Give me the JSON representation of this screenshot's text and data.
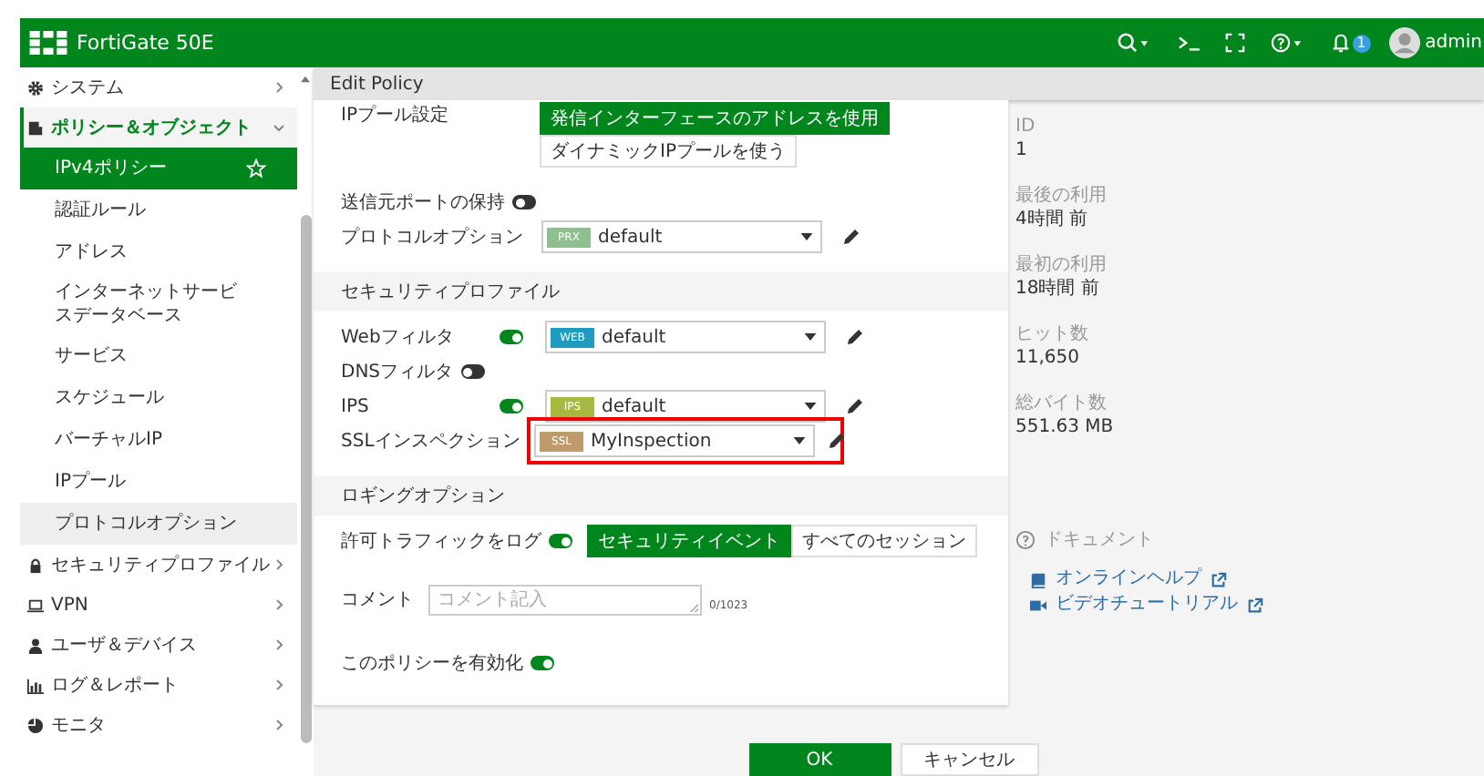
{
  "header": {
    "title": "FortiGate 50E",
    "notifications": "1",
    "user": "admin"
  },
  "sidebar": {
    "items": [
      {
        "label": "システム",
        "expanded": false,
        "selected": false,
        "hovered": false
      },
      {
        "label": "ポリシー＆オブジェクト",
        "expanded": true,
        "selected": false,
        "hovered": false,
        "children": [
          {
            "label": "IPv4ポリシー",
            "selected": true,
            "hovered": false
          },
          {
            "label": "認証ルール",
            "selected": false,
            "hovered": false
          },
          {
            "label": "アドレス",
            "selected": false,
            "hovered": false
          },
          {
            "label": "インターネットサービスデータベース",
            "selected": false,
            "hovered": false
          },
          {
            "label": "サービス",
            "selected": false,
            "hovered": false
          },
          {
            "label": "スケジュール",
            "selected": false,
            "hovered": false
          },
          {
            "label": "バーチャルIP",
            "selected": false,
            "hovered": false
          },
          {
            "label": "IPプール",
            "selected": false,
            "hovered": false
          },
          {
            "label": "プロトコルオプション",
            "selected": false,
            "hovered": true
          }
        ]
      },
      {
        "label": "セキュリティプロファイル",
        "expanded": false,
        "selected": false,
        "hovered": false
      },
      {
        "label": "VPN",
        "expanded": false,
        "selected": false,
        "hovered": false
      },
      {
        "label": "ユーザ＆デバイス",
        "expanded": false,
        "selected": false,
        "hovered": false
      },
      {
        "label": "ログ＆レポート",
        "expanded": false,
        "selected": false,
        "hovered": false
      },
      {
        "label": "モニタ",
        "expanded": false,
        "selected": false,
        "hovered": false
      }
    ]
  },
  "page_title": "Edit Policy",
  "form": {
    "rows": [
      {
        "kind": "options",
        "label": "IPプール設定",
        "options": [
          {
            "label": "発信インターフェースのアドレスを使用",
            "selected": true
          },
          {
            "label": "ダイナミックIPプールを使う",
            "selected": false
          }
        ]
      },
      {
        "kind": "toggle",
        "label": "送信元ポートの保持",
        "on": false
      },
      {
        "kind": "select",
        "label": "プロトコルオプション",
        "badge": "PRX",
        "color": "#8fbf8f",
        "value": "default"
      },
      {
        "kind": "section",
        "label": "セキュリティプロファイル"
      },
      {
        "kind": "toggle-select",
        "label": "Webフィルタ",
        "on": true,
        "badge": "WEB",
        "color": "#1f9bc0",
        "value": "default"
      },
      {
        "kind": "toggle",
        "label": "DNSフィルタ",
        "on": false
      },
      {
        "kind": "toggle-select",
        "label": "IPS",
        "on": true,
        "badge": "IPS",
        "color": "#a9b93f",
        "value": "default"
      },
      {
        "kind": "select",
        "label": "SSLインスペクション",
        "badge": "SSL",
        "color": "#bf9b6b",
        "value": "MyInspection",
        "highlighted": true
      },
      {
        "kind": "section",
        "label": "ロギングオプション"
      },
      {
        "kind": "toggle-options",
        "label": "許可トラフィックをログ",
        "on": true,
        "options": [
          {
            "label": "セキュリティイベント",
            "selected": true
          },
          {
            "label": "すべてのセッション",
            "selected": false
          }
        ]
      },
      {
        "kind": "comment",
        "label": "コメント",
        "placeholder": "コメント記入",
        "counter": "0/1023"
      },
      {
        "kind": "toggle",
        "label": "このポリシーを有効化",
        "on": true
      }
    ]
  },
  "info": [
    {
      "label": "ID",
      "value": "1"
    },
    {
      "label": "最後の利用",
      "value": "4時間 前"
    },
    {
      "label": "最初の利用",
      "value": "18時間 前"
    },
    {
      "label": "ヒット数",
      "value": "11,650"
    },
    {
      "label": "総バイト数",
      "value": "551.63 MB"
    }
  ],
  "docs": {
    "title": "ドキュメント",
    "links": [
      {
        "label": "オンラインヘルプ"
      },
      {
        "label": "ビデオチュートリアル"
      }
    ]
  },
  "buttons": [
    {
      "label": "OK",
      "primary": true
    },
    {
      "label": "キャンセル",
      "primary": false
    }
  ]
}
